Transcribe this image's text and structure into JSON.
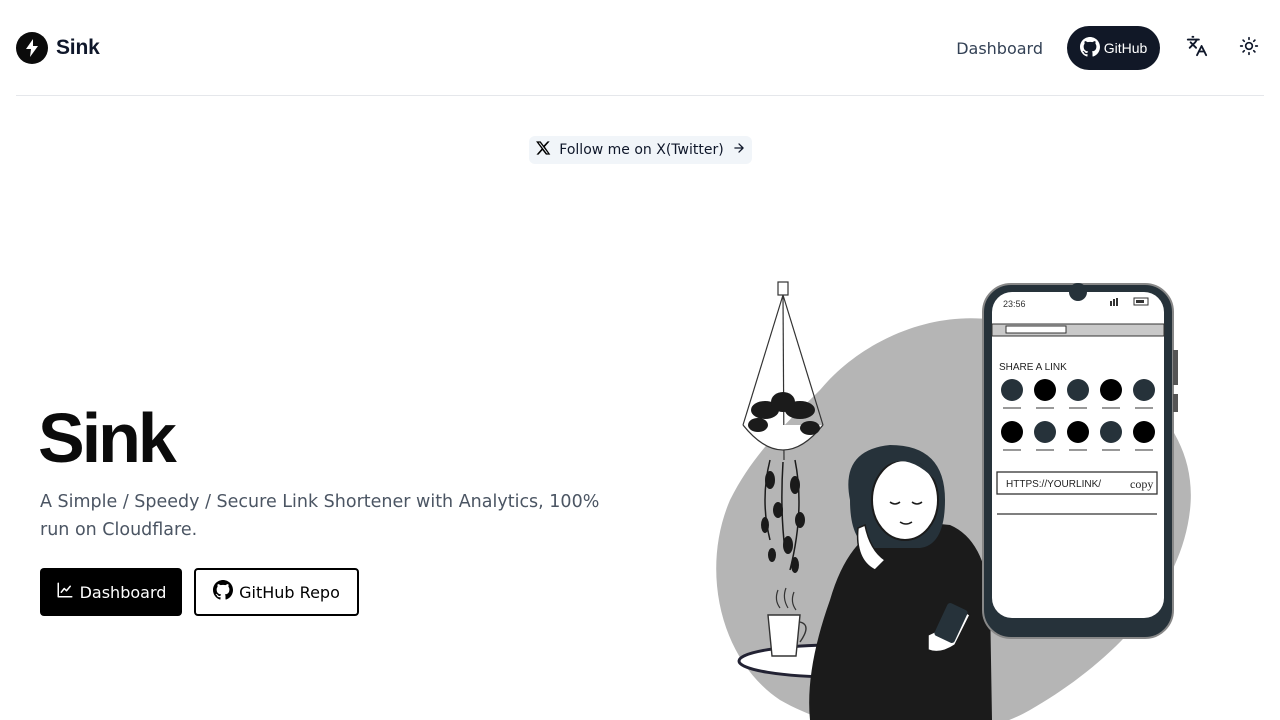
{
  "brand": {
    "name": "Sink",
    "logo_icon": "bolt-icon"
  },
  "nav": {
    "dashboard_label": "Dashboard",
    "github_label": "GitHub",
    "translate_icon": "translate-icon",
    "theme_icon": "sun-icon"
  },
  "announcement": {
    "label": "Follow me on X(Twitter)",
    "icon": "x-logo-icon",
    "arrow_icon": "arrow-right-icon"
  },
  "hero": {
    "title": "Sink",
    "subtitle": "A Simple / Speedy / Secure Link Shortener with Analytics, 100% run on Cloudflare.",
    "primary_button": "Dashboard",
    "secondary_button": "GitHub Repo"
  },
  "illustration": {
    "phone_time": "23:56",
    "phone_heading": "SHARE A LINK",
    "phone_url": "HTTPS://YOURLINK/",
    "phone_copy": "copy"
  },
  "colors": {
    "accent": "#111827",
    "text_muted": "#4b5563",
    "border": "#e5e7eb",
    "pill_bg": "#f1f5f9"
  }
}
